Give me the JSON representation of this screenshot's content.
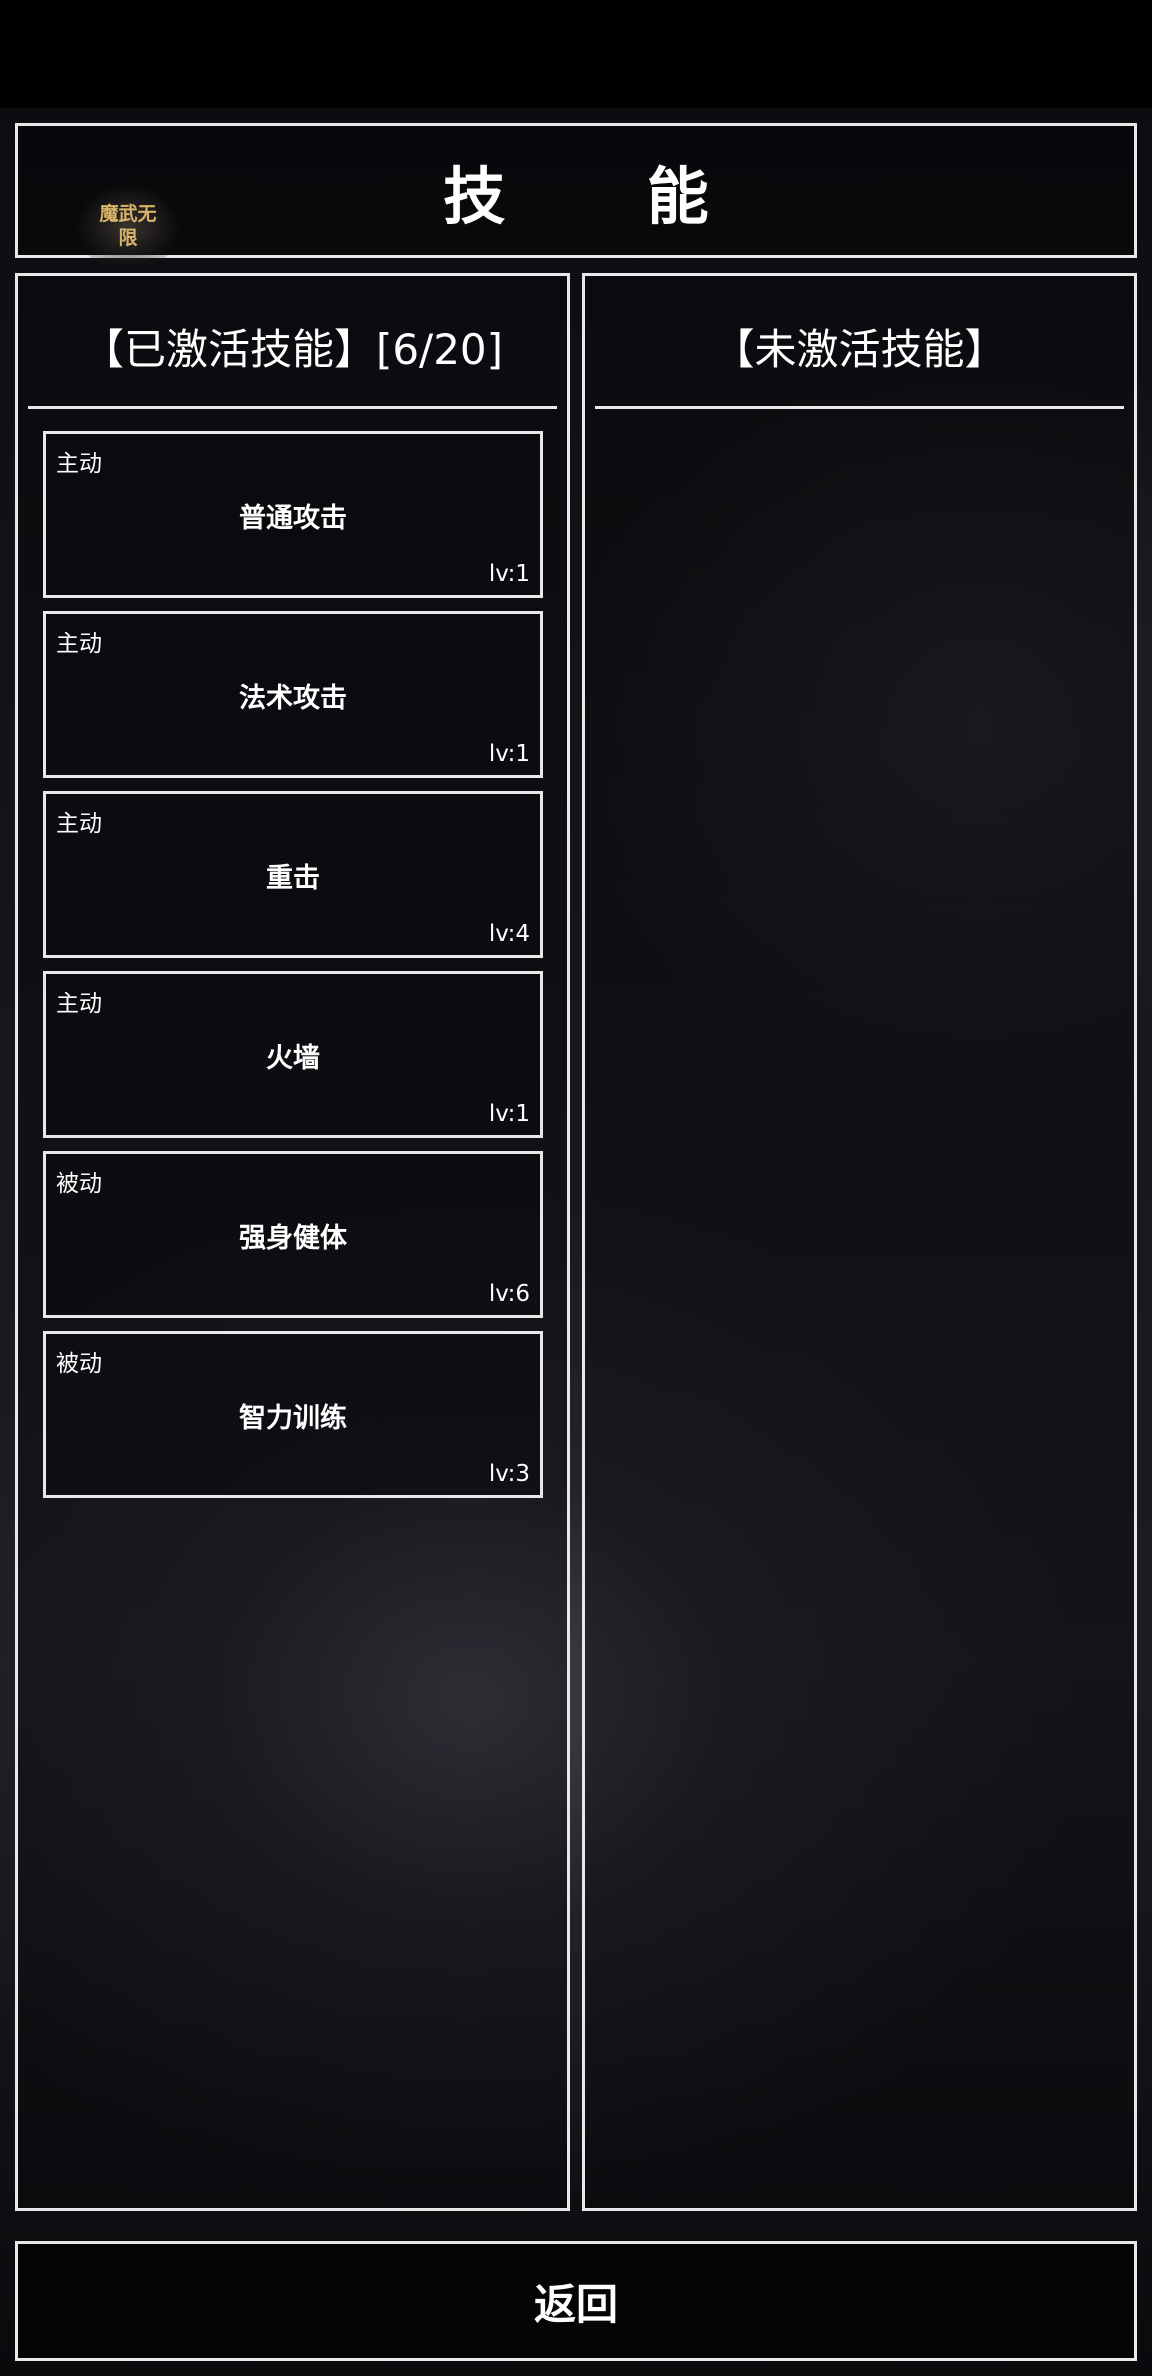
{
  "header": {
    "title": "技 能",
    "logo_text": "魔武无限"
  },
  "active_panel": {
    "title": "【已激活技能】[6/20]",
    "skills": [
      {
        "type": "主动",
        "name": "普通攻击",
        "level": "lv:1"
      },
      {
        "type": "主动",
        "name": "法术攻击",
        "level": "lv:1"
      },
      {
        "type": "主动",
        "name": "重击",
        "level": "lv:4"
      },
      {
        "type": "主动",
        "name": "火墙",
        "level": "lv:1"
      },
      {
        "type": "被动",
        "name": "强身健体",
        "level": "lv:6"
      },
      {
        "type": "被动",
        "name": "智力训练",
        "level": "lv:3"
      }
    ]
  },
  "inactive_panel": {
    "title": "【未激活技能】"
  },
  "footer": {
    "back_label": "返回"
  }
}
